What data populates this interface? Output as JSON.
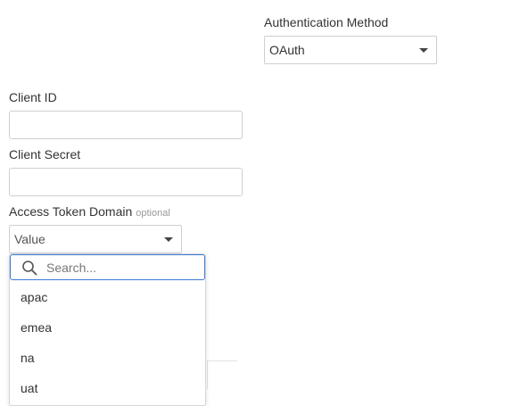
{
  "auth": {
    "label": "Authentication Method",
    "value": "OAuth"
  },
  "client_id": {
    "label": "Client ID",
    "value": ""
  },
  "client_secret": {
    "label": "Client Secret",
    "value": ""
  },
  "access_token_domain": {
    "label": "Access Token Domain",
    "optional": "optional",
    "value": "Value"
  },
  "dropdown": {
    "search_placeholder": "Search...",
    "options": [
      "apac",
      "emea",
      "na",
      "uat"
    ]
  },
  "colors": {
    "focus_border": "#3a7bd5",
    "border": "#cfcfcf",
    "text": "#333333"
  }
}
